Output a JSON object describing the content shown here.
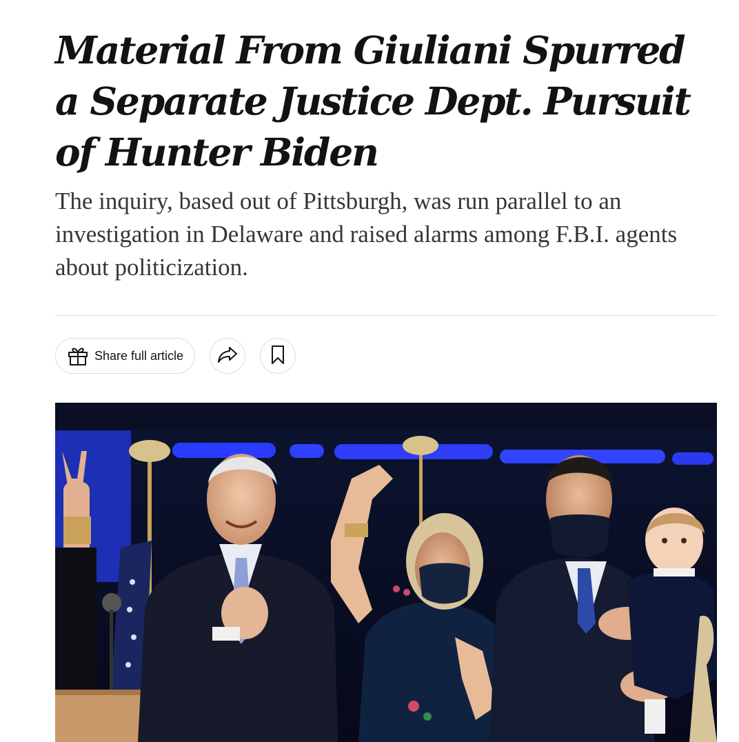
{
  "article": {
    "headline": "Material From Giuliani Spurred a Separate Justice Dept. Pursuit of Hunter Biden",
    "summary": "The inquiry, based out of Pittsburgh, was run parallel to an investigation in Delaware and raised alarms among F.B.I. agents about politicization."
  },
  "toolbar": {
    "share_label": "Share full article",
    "share_icon": "gift-icon",
    "forward_icon": "share-arrow-icon",
    "save_icon": "bookmark-icon"
  },
  "photo": {
    "subject": "lead-photo"
  },
  "colors": {
    "text": "#121212",
    "summary_text": "#363636",
    "divider": "#dfdfdf",
    "button_border": "#dcdcdc"
  }
}
